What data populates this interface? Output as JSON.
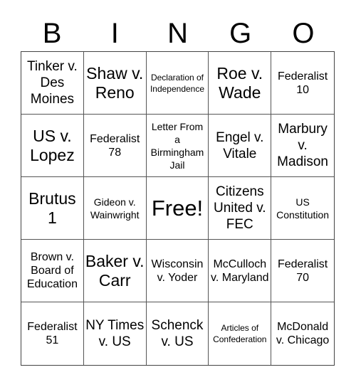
{
  "header": [
    "B",
    "I",
    "N",
    "G",
    "O"
  ],
  "cells": [
    {
      "text": "Tinker v. Des Moines",
      "size": "md"
    },
    {
      "text": "Shaw v. Reno",
      "size": "lg"
    },
    {
      "text": "Declaration of Independence",
      "size": "xxs"
    },
    {
      "text": "Roe v. Wade",
      "size": "lg"
    },
    {
      "text": "Federalist 10",
      "size": "sm"
    },
    {
      "text": "US v. Lopez",
      "size": "lg"
    },
    {
      "text": "Federalist 78",
      "size": "sm"
    },
    {
      "text": "Letter From a Birmingham Jail",
      "size": "xs"
    },
    {
      "text": "Engel v. Vitale",
      "size": "md"
    },
    {
      "text": "Marbury v. Madison",
      "size": "md"
    },
    {
      "text": "Brutus 1",
      "size": "lg"
    },
    {
      "text": "Gideon v. Wainwright",
      "size": "xs"
    },
    {
      "text": "Free!",
      "size": "xl"
    },
    {
      "text": "Citizens United v. FEC",
      "size": "md"
    },
    {
      "text": "US Constitution",
      "size": "xs"
    },
    {
      "text": "Brown v. Board of Education",
      "size": "sm"
    },
    {
      "text": "Baker v. Carr",
      "size": "lg"
    },
    {
      "text": "Wisconsin v. Yoder",
      "size": "sm"
    },
    {
      "text": "McCulloch v. Maryland",
      "size": "sm"
    },
    {
      "text": "Federalist 70",
      "size": "sm"
    },
    {
      "text": "Federalist 51",
      "size": "sm"
    },
    {
      "text": "NY Times v. US",
      "size": "md"
    },
    {
      "text": "Schenck v. US",
      "size": "md"
    },
    {
      "text": "Articles of Confederation",
      "size": "xxs"
    },
    {
      "text": "McDonald v. Chicago",
      "size": "sm"
    }
  ]
}
